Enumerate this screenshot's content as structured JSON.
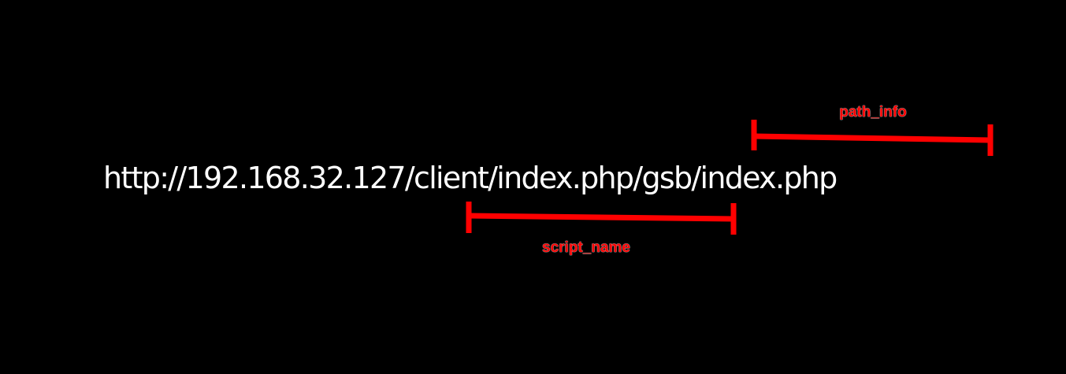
{
  "diagram": {
    "url": "http://192.168.32.127/client/index.php/gsb/index.php",
    "labels": {
      "path_info": "path_info",
      "script_name": "script_name"
    },
    "colors": {
      "background": "#000000",
      "text": "#ffffff",
      "annotation": "#ff0000"
    }
  }
}
